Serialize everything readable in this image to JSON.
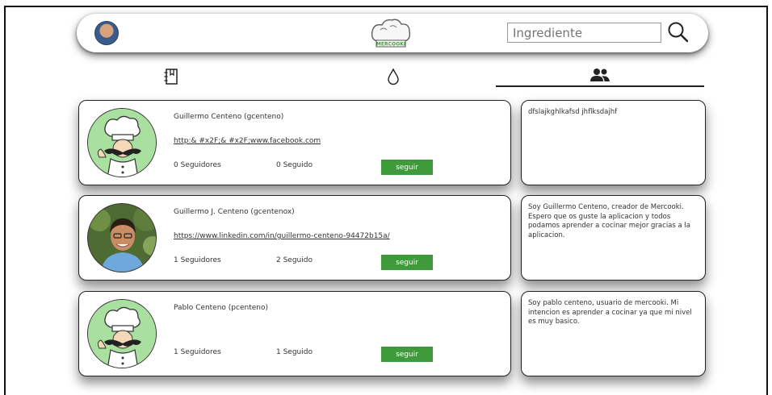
{
  "header": {
    "logo_text": "MERCOOKI",
    "search": {
      "placeholder": "Ingrediente",
      "value": ""
    }
  },
  "tabs": [
    {
      "id": "recipes",
      "icon": "book-icon",
      "active": false
    },
    {
      "id": "ingredients",
      "icon": "drop-icon",
      "active": false
    },
    {
      "id": "users",
      "icon": "users-icon",
      "active": true
    }
  ],
  "users": [
    {
      "name": "Guillermo Centeno (gcenteno)",
      "link": "http:& #x2F;& #x2F;www.facebook.com",
      "followers": "0 Seguidores",
      "following": "0 Seguido",
      "button": "seguir",
      "avatar": "chef-icon",
      "bio": "dfslajkghlkafsd jhflksdajhf"
    },
    {
      "name": "Guillermo J. Centeno (gcentenox)",
      "link": "https://www.linkedin.com/in/guillermo-centeno-94472b15a/",
      "followers": "1 Seguidores",
      "following": "2 Seguido",
      "button": "seguir",
      "avatar": "person-photo",
      "bio": "Soy Guillermo Centeno, creador de Mercooki. Espero que os guste la aplicacion y todos podamos aprender a cocinar mejor gracias a la aplicacion."
    },
    {
      "name": "Pablo Centeno (pcenteno)",
      "link": "",
      "followers": "1 Seguidores",
      "following": "1 Seguido",
      "button": "seguir",
      "avatar": "chef-icon",
      "bio": "Soy pablo centeno, usuario de mercooki. Mi intencion es aprender a cocinar ya que mi nivel es muy basico."
    }
  ],
  "colors": {
    "follow_button": "#3e9a3a",
    "chef_background": "#a9e0a0"
  }
}
